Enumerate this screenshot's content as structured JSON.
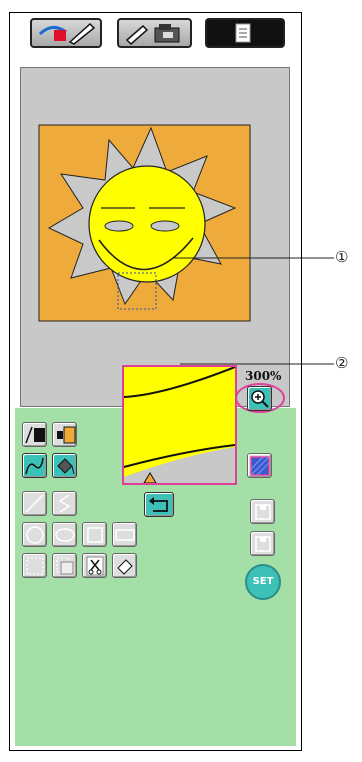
{
  "toolbar": {
    "buttons": [
      {
        "name": "line-color-pen-tab",
        "icon": "color-pencil-icon"
      },
      {
        "name": "stitch-pen-tab",
        "icon": "pen-machine-icon"
      },
      {
        "name": "list-tab",
        "icon": "document-list-icon"
      }
    ]
  },
  "preview": {
    "zoom_label": "300%",
    "fill_color": "#fff200"
  },
  "callouts": {
    "one": "①",
    "two": "②"
  },
  "colors": {
    "panel_green": "#a4dfa8",
    "teal": "#3cc0b8",
    "sun_orange": "#efaa3c",
    "sun_yellow": "#ffff00",
    "highlight_pink": "#e0409a"
  },
  "set_button": {
    "label": "SET"
  }
}
